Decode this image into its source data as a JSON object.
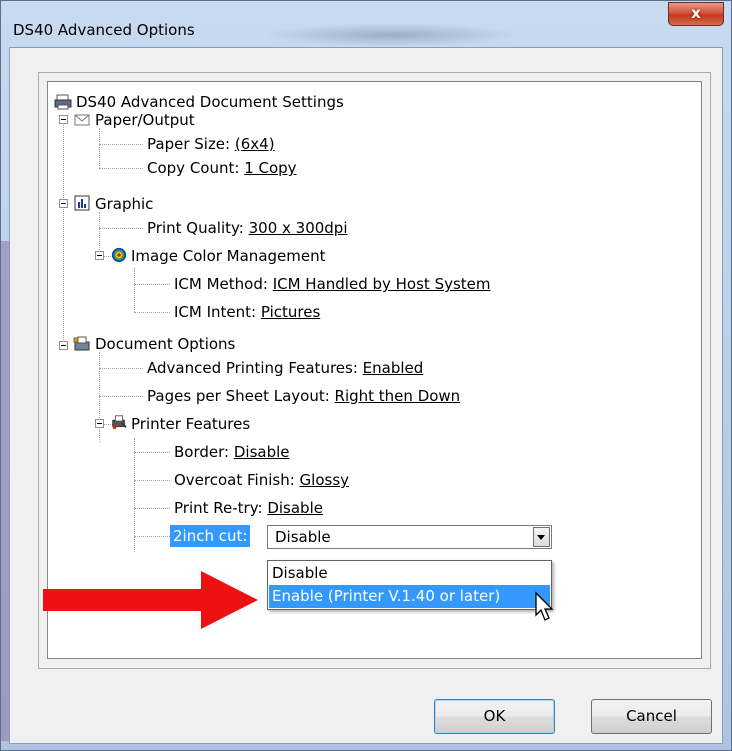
{
  "window": {
    "title": "DS40 Advanced Options",
    "close_label": "x"
  },
  "tree": {
    "root": "DS40 Advanced Document Settings",
    "paper_output": {
      "label": "Paper/Output",
      "paper_size": {
        "label": "Paper Size: ",
        "value": "(6x4)"
      },
      "copy_count": {
        "label": "Copy Count: ",
        "value": "1 Copy"
      }
    },
    "graphic": {
      "label": "Graphic",
      "print_quality": {
        "label": "Print Quality: ",
        "value": "300 x 300dpi"
      },
      "icm": {
        "label": "Image Color Management",
        "method": {
          "label": "ICM Method: ",
          "value": "ICM Handled by Host System"
        },
        "intent": {
          "label": "ICM Intent: ",
          "value": "Pictures"
        }
      }
    },
    "document_options": {
      "label": "Document Options",
      "advanced": {
        "label": "Advanced Printing Features: ",
        "value": "Enabled"
      },
      "pages_layout": {
        "label": "Pages per Sheet Layout: ",
        "value": "Right then Down"
      },
      "printer_features": {
        "label": "Printer Features",
        "border": {
          "label": "Border: ",
          "value": "Disable"
        },
        "overcoat": {
          "label": "Overcoat Finish: ",
          "value": "Glossy"
        },
        "retry": {
          "label": "Print Re-try: ",
          "value": "Disable"
        },
        "cut": {
          "label": "2inch cut:",
          "selected": "Disable",
          "options": [
            "Disable",
            "Enable (Printer V.1.40 or later)"
          ]
        }
      }
    }
  },
  "buttons": {
    "ok": "OK",
    "cancel": "Cancel"
  },
  "colors": {
    "selection": "#3399ff",
    "arrow": "#ee1111"
  }
}
